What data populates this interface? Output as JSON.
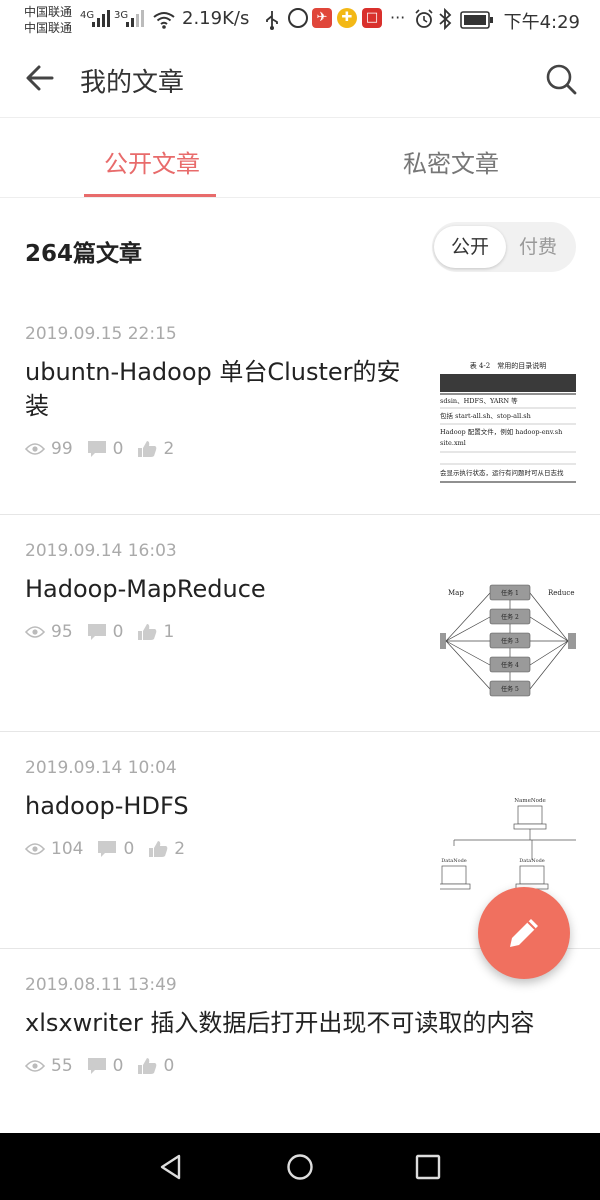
{
  "status_bar": {
    "carrier1": "中国联通",
    "carrier2": "中国联通",
    "net1": "4G",
    "net2": "3G",
    "speed": "2.19K/s",
    "more": "···",
    "time": "下午4:29"
  },
  "header": {
    "title": "我的文章"
  },
  "tabs": [
    {
      "label": "公开文章"
    },
    {
      "label": "私密文章"
    }
  ],
  "summary": {
    "count": "264篇文章",
    "toggle_on": "公开",
    "toggle_off": "付费"
  },
  "articles": [
    {
      "date": "2019.09.15 22:15",
      "title": "ubuntn-Hadoop  单台Cluster的安装",
      "views": "99",
      "comments": "0",
      "likes": "2",
      "has_thumb": true
    },
    {
      "date": "2019.09.14 16:03",
      "title": "Hadoop-MapReduce",
      "views": "95",
      "comments": "0",
      "likes": "1",
      "has_thumb": true
    },
    {
      "date": "2019.09.14 10:04",
      "title": "hadoop-HDFS",
      "views": "104",
      "comments": "0",
      "likes": "2",
      "has_thumb": true
    },
    {
      "date": "2019.08.11 13:49",
      "title": "xlsxwriter 插入数据后打开出现不可读取的内容",
      "views": "55",
      "comments": "0",
      "likes": "0",
      "has_thumb": false
    }
  ],
  "thumb_text": {
    "t1": {
      "caption": "表 4-2　常用的目录说明",
      "row1": "sdsin、HDFS、YARN 等",
      "row2": "包括 start-all.sh、stop-all.sh",
      "row3": "Hadoop 配置文件，例如 hadoop-env.sh",
      "row4": "site.xml",
      "row5": "会显示执行状态，运行有问题时可从日志找"
    },
    "t2": {
      "left": "Map",
      "right": "Reduce",
      "task1": "任务 1",
      "task2": "任务 2",
      "task3": "任务 3",
      "task4": "任务 4",
      "task5": "任务 5"
    },
    "t3": {
      "top": "NameNode",
      "left": "DataNode",
      "right": "DataNode"
    }
  },
  "colors": {
    "accent": "#e86b6b",
    "fab": "#f0705f",
    "muted": "#aaaaaa"
  }
}
